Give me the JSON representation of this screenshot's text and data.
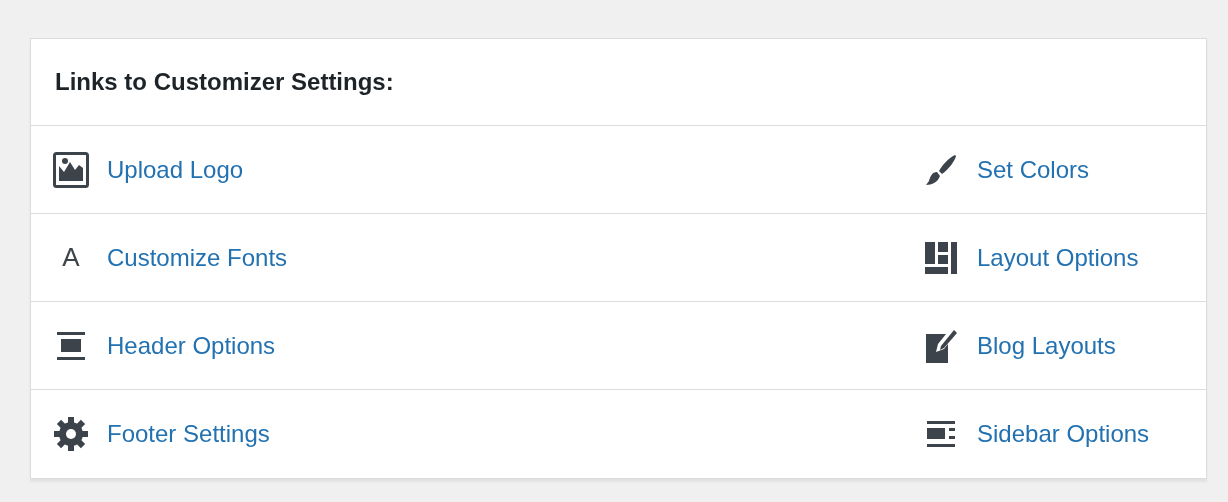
{
  "panel": {
    "title": "Links to Customizer Settings:"
  },
  "links": [
    {
      "label": "Upload Logo",
      "kind": "image"
    },
    {
      "label": "Set Colors",
      "kind": "brush"
    },
    {
      "label": "Customize Fonts",
      "kind": "letter",
      "glyph": "A"
    },
    {
      "label": "Layout Options",
      "kind": "layout"
    },
    {
      "label": "Header Options",
      "kind": "header"
    },
    {
      "label": "Blog Layouts",
      "kind": "edit"
    },
    {
      "label": "Footer Settings",
      "kind": "gear"
    },
    {
      "label": "Sidebar Options",
      "kind": "sidebar"
    }
  ]
}
